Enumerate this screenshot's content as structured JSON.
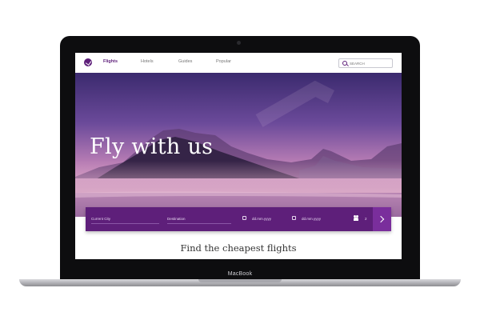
{
  "device": {
    "label": "MacBook"
  },
  "nav": {
    "items": [
      {
        "label": "Flights",
        "active": true
      },
      {
        "label": "Hotels",
        "active": false
      },
      {
        "label": "Guides",
        "active": false
      },
      {
        "label": "Popular",
        "active": false
      }
    ],
    "search_placeholder": "SEARCH"
  },
  "hero": {
    "title": "Fly with us"
  },
  "booking": {
    "current_city_label": "Current City",
    "destination_label": "Destination",
    "depart_date": "dd.mm.yyyy",
    "return_date": "dd.mm.yyyy",
    "passengers": "2"
  },
  "section": {
    "subtitle": "Find the cheapest flights"
  },
  "colors": {
    "brand": "#5e1f7a",
    "accent": "#7a2e9c"
  }
}
